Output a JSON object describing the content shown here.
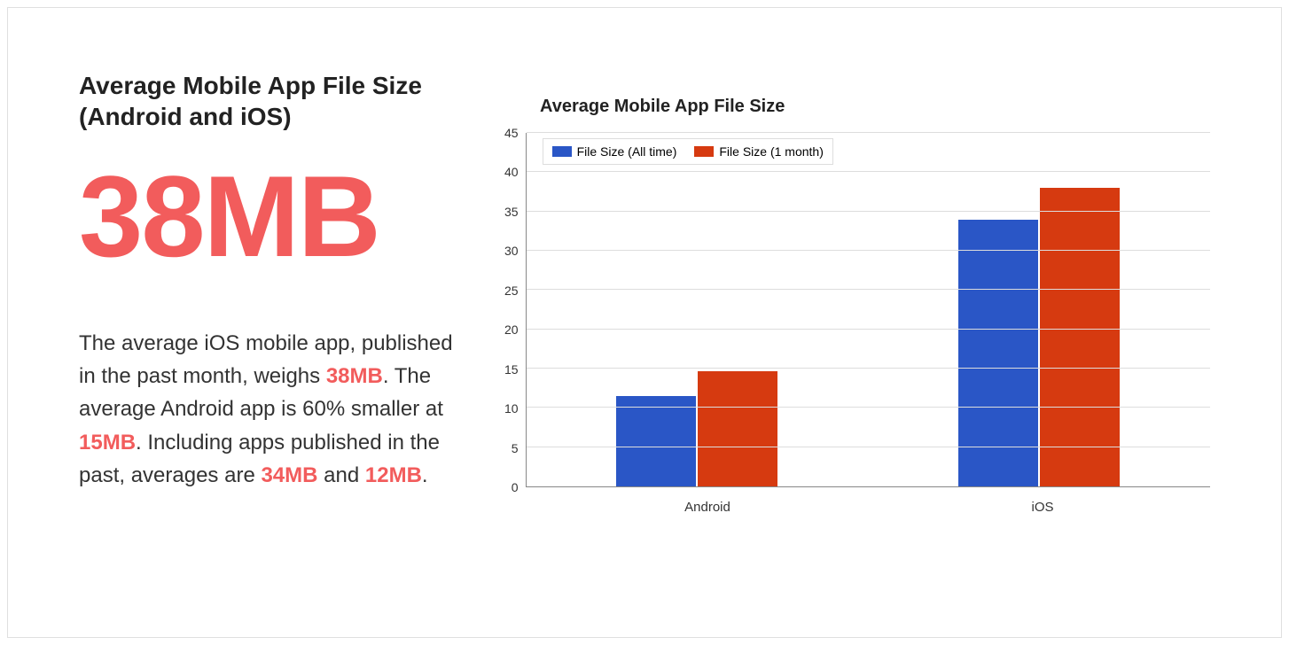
{
  "left": {
    "heading": "Average Mobile App File Size (Android and iOS)",
    "big_number": "38MB",
    "desc_1a": "The average iOS mobile app, published in the past month, weighs ",
    "desc_1b": "38MB",
    "desc_1c": ". The average Android app is 60% smaller at ",
    "desc_1d": "15MB",
    "desc_1e": ". Including apps published in the past, averages are ",
    "desc_1f": "34MB",
    "desc_1g": " and ",
    "desc_1h": "12MB",
    "desc_1i": "."
  },
  "chart_data": {
    "type": "bar",
    "title": "Average Mobile App File Size",
    "categories": [
      "Android",
      "iOS"
    ],
    "series": [
      {
        "name": "File Size (All time)",
        "values": [
          11.5,
          34
        ],
        "color": "#2a56c6"
      },
      {
        "name": "File Size (1 month)",
        "values": [
          14.7,
          38
        ],
        "color": "#d63a10"
      }
    ],
    "ylabel": "",
    "xlabel": "",
    "ylim": [
      0,
      45
    ],
    "y_ticks": [
      45,
      40,
      35,
      30,
      25,
      20,
      15,
      10,
      5,
      0
    ]
  }
}
